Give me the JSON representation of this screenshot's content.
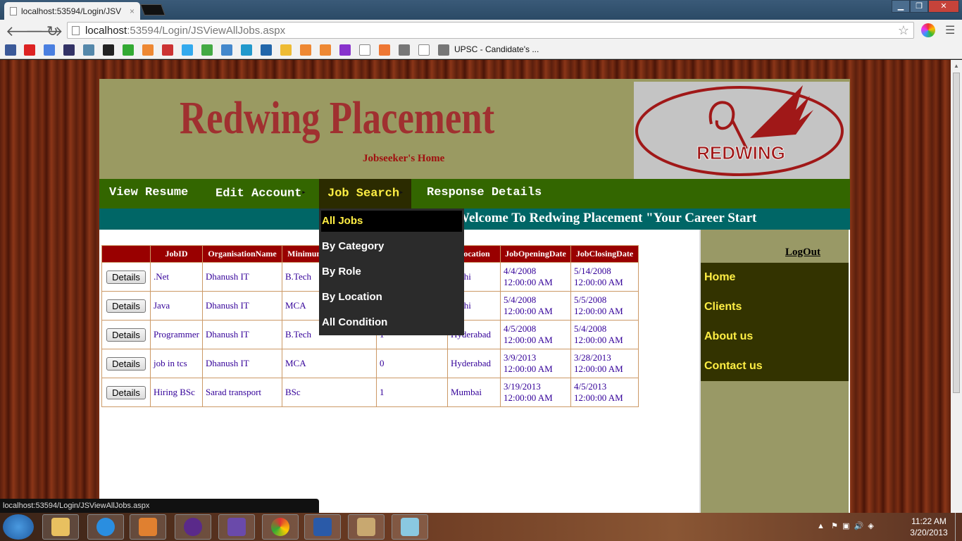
{
  "browser": {
    "tab_title": "localhost:53594/Login/JSV",
    "tab_close": "×",
    "url_host": "localhost",
    "url_path": ":53594/Login/JSViewAllJobs.aspx",
    "bookmark_label": "UPSC - Candidate's ...",
    "status_url": "localhost:53594/Login/JSViewAllJobs.aspx"
  },
  "header": {
    "title": "Redwing Placement",
    "subtitle": "Jobseeker's Home",
    "logo_text": "REDWING"
  },
  "nav": {
    "items": [
      {
        "label": "View Resume",
        "has_arrow": false
      },
      {
        "label": "Edit Account",
        "has_arrow": true
      },
      {
        "label": "Job Search",
        "has_arrow": true
      },
      {
        "label": "Response Details",
        "has_arrow": false
      }
    ]
  },
  "marquee": "Welcome To Redwing Placement \"Your Career Start",
  "dropdown": {
    "items": [
      "All Jobs",
      "By Category",
      "By Role",
      "By Location",
      "All Condition"
    ]
  },
  "table": {
    "headers": [
      "",
      "JobID",
      "OrganisationName",
      "MinimumQualification",
      "",
      "Location",
      "JobOpeningDate",
      "JobClosingDate"
    ],
    "rows": [
      {
        "button": "Details",
        "cells": [
          ".Net",
          "Dhanush IT",
          "B.Tech",
          "",
          "Delhi",
          "4/4/2008 12:00:00 AM",
          "5/14/2008 12:00:00 AM"
        ]
      },
      {
        "button": "Details",
        "cells": [
          "Java",
          "Dhanush IT",
          "MCA",
          "",
          "Delhi",
          "5/4/2008 12:00:00 AM",
          "5/5/2008 12:00:00 AM"
        ]
      },
      {
        "button": "Details",
        "cells": [
          "Programmer",
          "Dhanush IT",
          "B.Tech",
          "1",
          "Hyderabad",
          "4/5/2008 12:00:00 AM",
          "5/4/2008 12:00:00 AM"
        ]
      },
      {
        "button": "Details",
        "cells": [
          "job in tcs",
          "Dhanush IT",
          "MCA",
          "0",
          "Hyderabad",
          "3/9/2013 12:00:00 AM",
          "3/28/2013 12:00:00 AM"
        ]
      },
      {
        "button": "Details",
        "cells": [
          "Hiring BSc",
          "Sarad transport",
          "BSc",
          "1",
          "Mumbai",
          "3/19/2013 12:00:00 AM",
          "4/5/2013 12:00:00 AM"
        ]
      }
    ]
  },
  "sidebar": {
    "logout": "LogOut",
    "items": [
      "Home",
      "Clients",
      "About us",
      "Contact us"
    ]
  },
  "taskbar": {
    "time": "11:22 AM",
    "date": "3/20/2013"
  },
  "colors": {
    "header_bg": "#9a9a62",
    "title_red": "#a03030",
    "nav_green": "#336600",
    "marquee_teal": "#006666",
    "table_header": "#990000",
    "highlight_yellow": "#ffee44"
  }
}
